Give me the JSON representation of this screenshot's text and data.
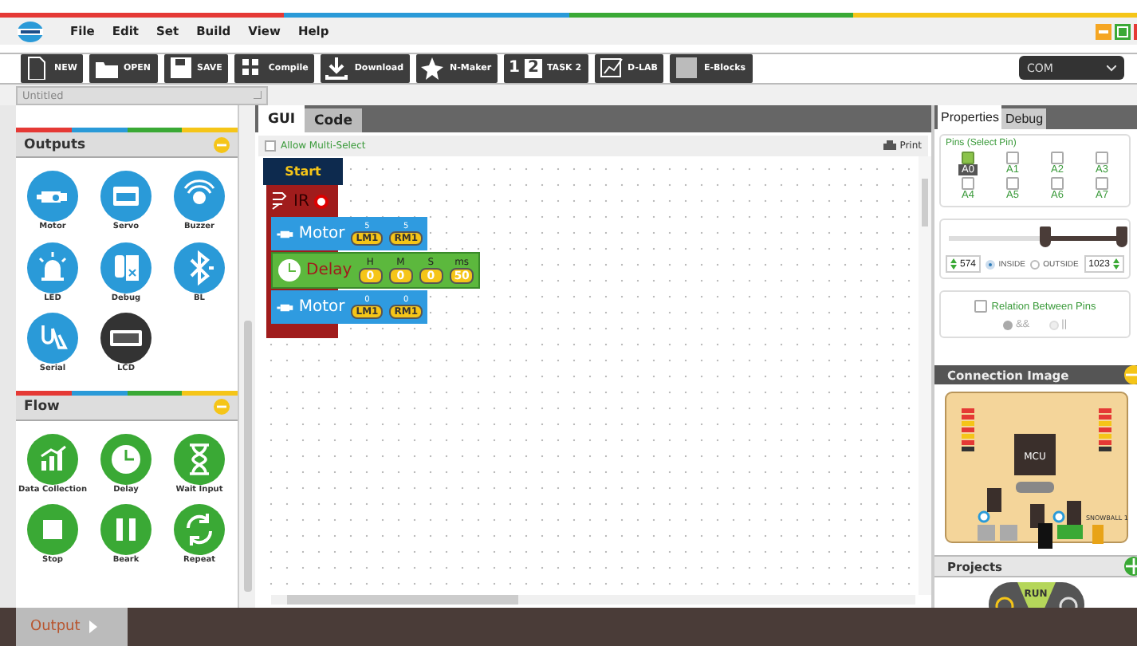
{
  "window": {
    "menu": [
      "File",
      "Edit",
      "Set",
      "Build",
      "View",
      "Help"
    ]
  },
  "toolbar": [
    {
      "label": "NEW",
      "kind": "new"
    },
    {
      "label": "OPEN",
      "kind": "open"
    },
    {
      "label": "SAVE",
      "kind": "save"
    },
    {
      "label": "Compile",
      "kind": "compile"
    },
    {
      "label": "Download",
      "kind": "download"
    },
    {
      "label": "N-Maker",
      "kind": "nmaker"
    },
    {
      "label": "TASK 2",
      "kind": "task",
      "icon_text": [
        "1",
        "2"
      ]
    },
    {
      "label": "D-LAB",
      "kind": "dlab"
    },
    {
      "label": "E-Blocks",
      "kind": "eblocks"
    }
  ],
  "port_select": {
    "value": "COM"
  },
  "document_tab": {
    "title": "Untitled"
  },
  "palette": [
    {
      "title": "Outputs",
      "color": "#2a9ad8",
      "items": [
        {
          "label": "Motor",
          "kind": "motor"
        },
        {
          "label": "Servo",
          "kind": "servo"
        },
        {
          "label": "Buzzer",
          "kind": "buzzer"
        },
        {
          "label": "LED",
          "kind": "led"
        },
        {
          "label": "Debug",
          "kind": "debug"
        },
        {
          "label": "BL",
          "kind": "bluetooth"
        },
        {
          "label": "Serial",
          "kind": "serial"
        },
        {
          "label": "LCD",
          "kind": "lcd"
        }
      ]
    },
    {
      "title": "Flow",
      "color": "#3aa935",
      "items": [
        {
          "label": "Data Collection",
          "kind": "chart"
        },
        {
          "label": "Delay",
          "kind": "clock"
        },
        {
          "label": "Wait Input",
          "kind": "hourglass"
        },
        {
          "label": "Stop",
          "kind": "stop"
        },
        {
          "label": "Beark",
          "kind": "pause"
        },
        {
          "label": "Repeat",
          "kind": "repeat"
        }
      ]
    }
  ],
  "editor_tabs": [
    {
      "label": "GUI",
      "selected": true
    },
    {
      "label": "Code",
      "selected": false
    }
  ],
  "allow_multi_select": {
    "label": "Allow Multi-Select",
    "checked": false
  },
  "print": "Print",
  "program": {
    "start": "Start",
    "condition": {
      "label": "IR",
      "body": [
        {
          "kind": "motor",
          "label": "Motor",
          "params": [
            {
              "name": "5",
              "value": "LM1"
            },
            {
              "name": "5",
              "value": "RM1"
            }
          ]
        },
        {
          "kind": "delay",
          "label": "Delay",
          "params": [
            {
              "name": "H",
              "value": "0"
            },
            {
              "name": "M",
              "value": "0"
            },
            {
              "name": "S",
              "value": "0"
            },
            {
              "name": "ms",
              "value": "50"
            }
          ]
        },
        {
          "kind": "motor",
          "label": "Motor",
          "params": [
            {
              "name": "0",
              "value": "LM1"
            },
            {
              "name": "0",
              "value": "RM1"
            }
          ]
        }
      ]
    }
  },
  "side_tabs": [
    {
      "label": "Properties",
      "selected": true
    },
    {
      "label": "Debug",
      "selected": false
    }
  ],
  "pins": {
    "title": "Pins (Select Pin)",
    "items": [
      {
        "label": "A0",
        "checked": true,
        "selected": true
      },
      {
        "label": "A1",
        "checked": false,
        "selected": false
      },
      {
        "label": "A2",
        "checked": false,
        "selected": false
      },
      {
        "label": "A3",
        "checked": false,
        "selected": false
      },
      {
        "label": "A4",
        "checked": false,
        "selected": false
      },
      {
        "label": "A5",
        "checked": false,
        "selected": false
      },
      {
        "label": "A6",
        "checked": false,
        "selected": false
      },
      {
        "label": "A7",
        "checked": false,
        "selected": false
      }
    ]
  },
  "range": {
    "low": {
      "level": 0.56,
      "reading": "574"
    },
    "high": {
      "level": 1,
      "reading": "1023"
    },
    "modes": [
      {
        "label": "INSIDE",
        "selected": true
      },
      {
        "label": "OUTSIDE",
        "selected": false
      }
    ]
  },
  "relation": {
    "label": "Relation Between Pins",
    "checked": false,
    "operators": [
      {
        "label": "&&",
        "selected": true
      },
      {
        "label": "||",
        "selected": false
      }
    ]
  },
  "connection_image": {
    "title": "Connection Image",
    "labels": [
      "MCU",
      "SNOWBALL 1"
    ]
  },
  "projects": {
    "title": "Projects",
    "run": "RUN"
  },
  "output": {
    "label": "Output"
  }
}
